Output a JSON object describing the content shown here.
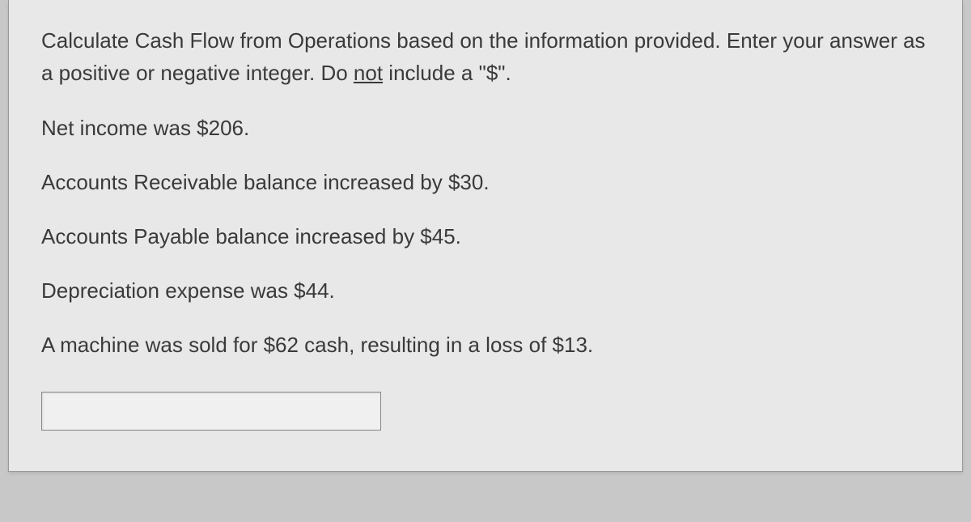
{
  "prompt": {
    "part1": "Calculate Cash Flow from Operations based on the information provided. Enter your answer as a positive or negative integer. Do ",
    "underlined": "not",
    "part2": " include a \"$\"."
  },
  "lines": [
    "Net income was $206.",
    "Accounts Receivable balance increased by $30.",
    "Accounts Payable balance increased by $45.",
    "Depreciation expense was $44.",
    "A machine was sold for $62 cash, resulting in a loss of $13."
  ],
  "answer": {
    "value": "",
    "placeholder": ""
  }
}
